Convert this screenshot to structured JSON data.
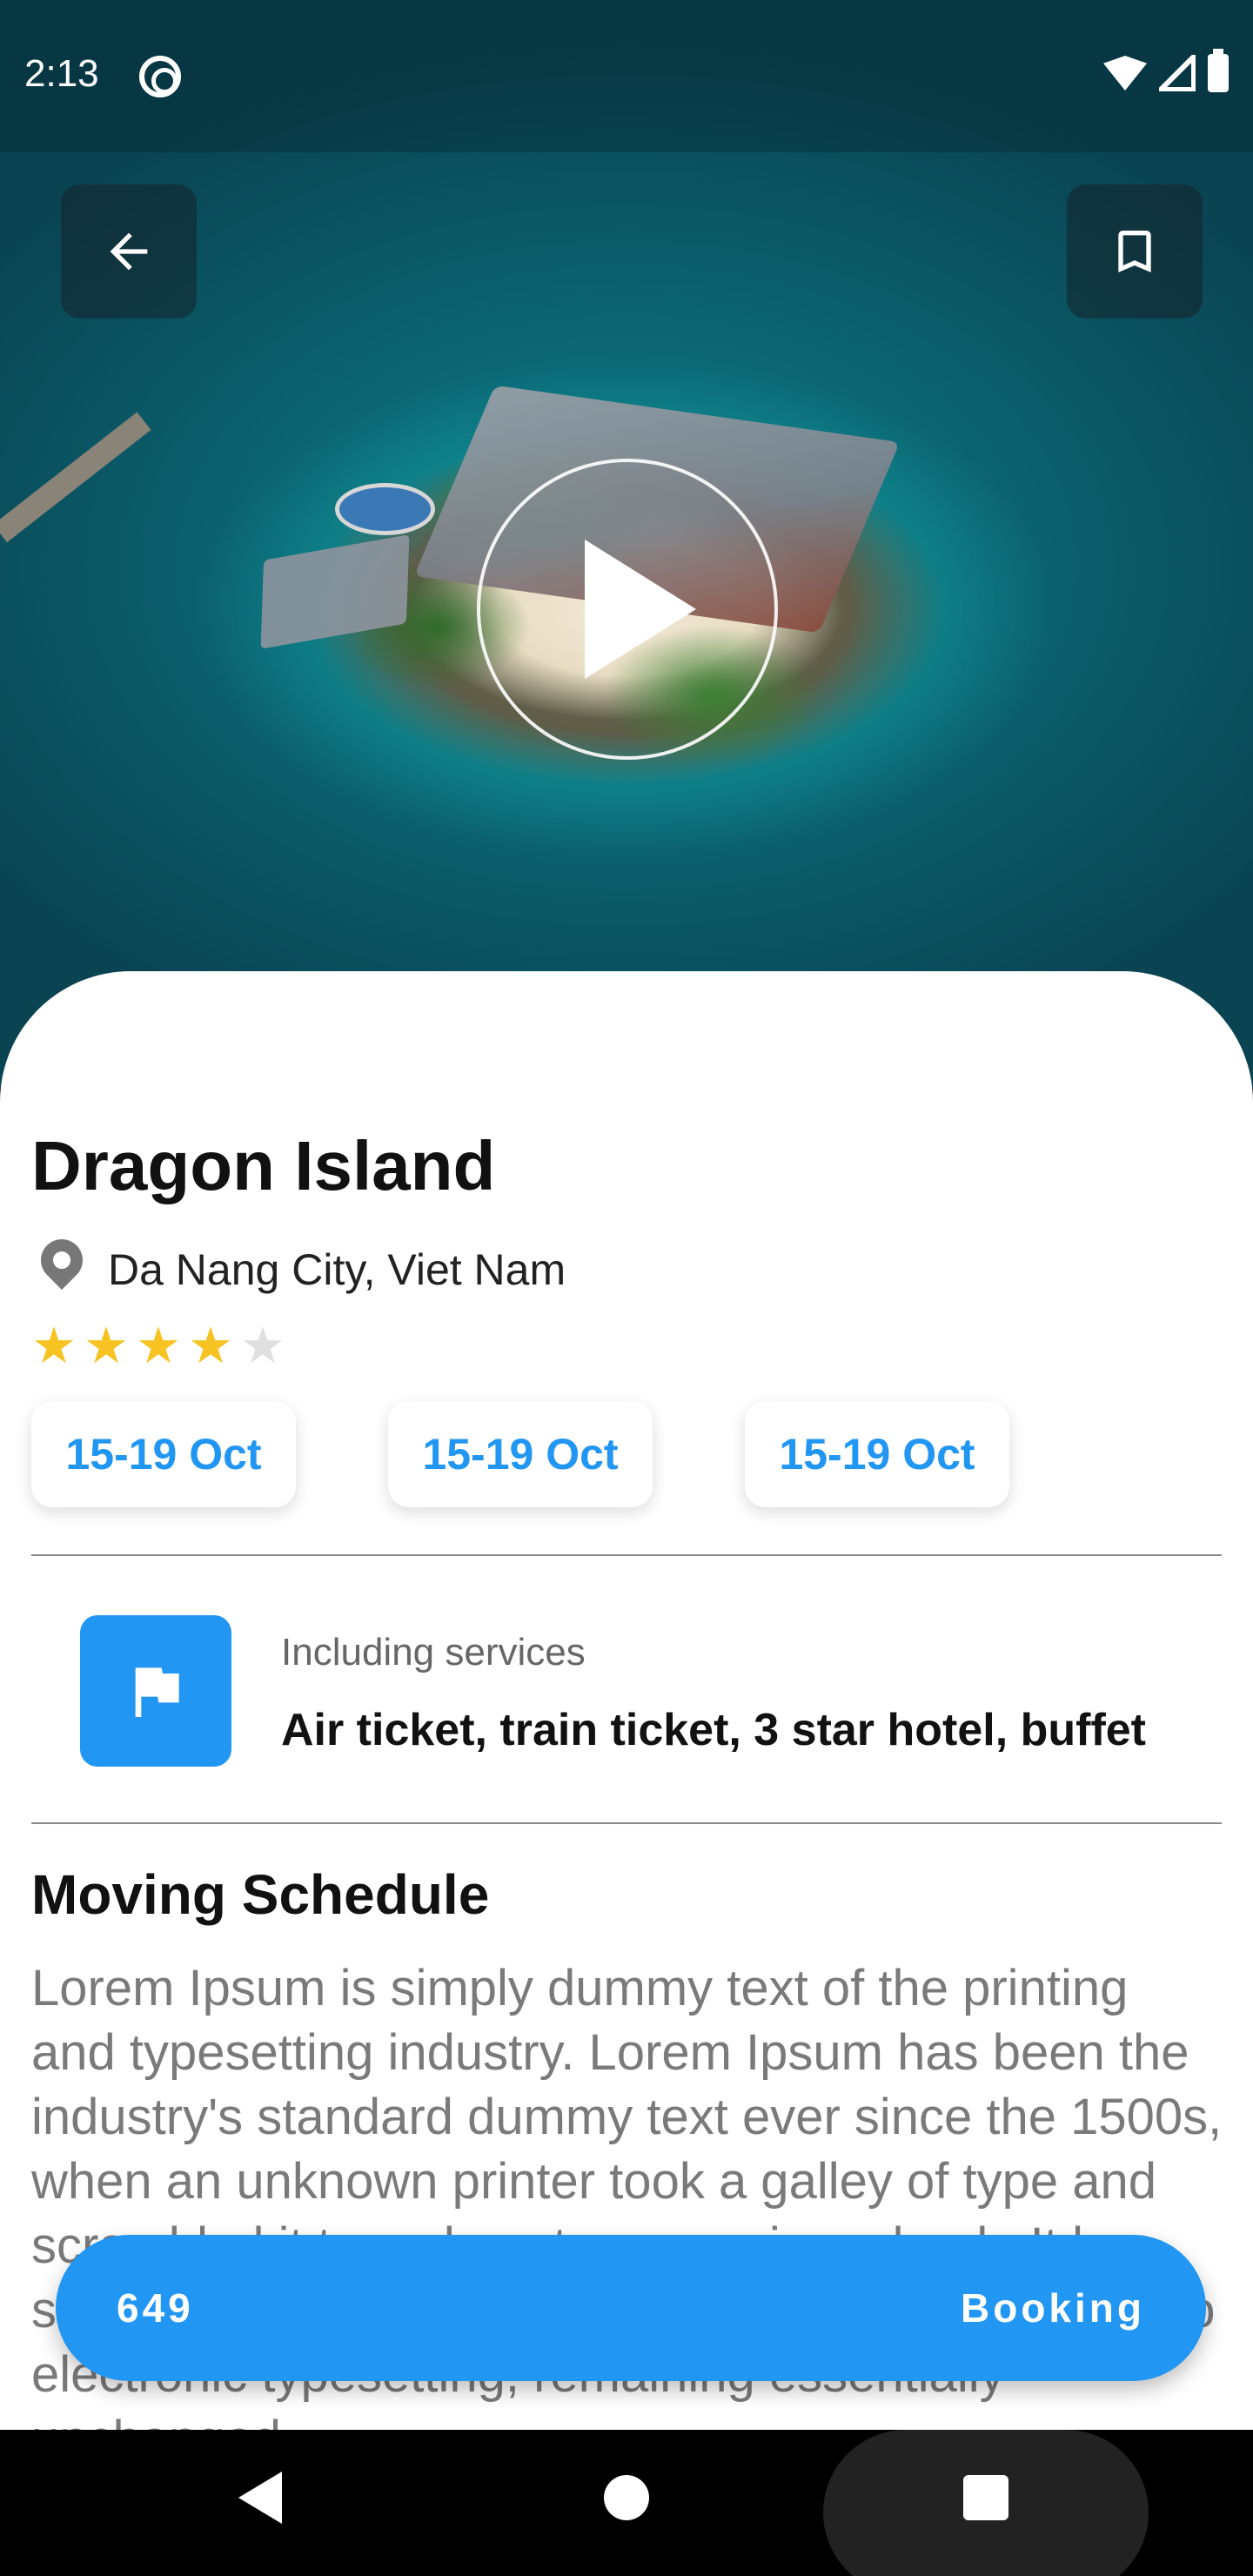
{
  "status_bar": {
    "time": "2:13"
  },
  "hero": {
    "back_icon": "arrow-back-icon",
    "bookmark_icon": "bookmark-icon",
    "play_icon": "play-icon"
  },
  "place": {
    "title": "Dragon Island",
    "location": "Da Nang City, Viet Nam",
    "rating": 4,
    "rating_max": 5
  },
  "dates": [
    {
      "label": "15-19 Oct"
    },
    {
      "label": "15-19 Oct"
    },
    {
      "label": "15-19 Oct"
    }
  ],
  "services": {
    "label": "Including services",
    "value": "Air ticket, train ticket, 3 star hotel, buffet",
    "icon": "flag-icon"
  },
  "schedule": {
    "title": "Moving Schedule",
    "description": "Lorem Ipsum is simply dummy text of the printing and typesetting industry. Lorem Ipsum has been the industry's standard dummy text ever since the 1500s, when an unknown printer took a galley of type and scrambled it to make a type specimen book. It has survived not only five centuries, but also the leap into electronic typesetting, remaining essentially unchanged."
  },
  "booking": {
    "price": "649",
    "button_label": "Booking"
  },
  "colors": {
    "accent": "#2196f3",
    "star": "#f6c322"
  }
}
